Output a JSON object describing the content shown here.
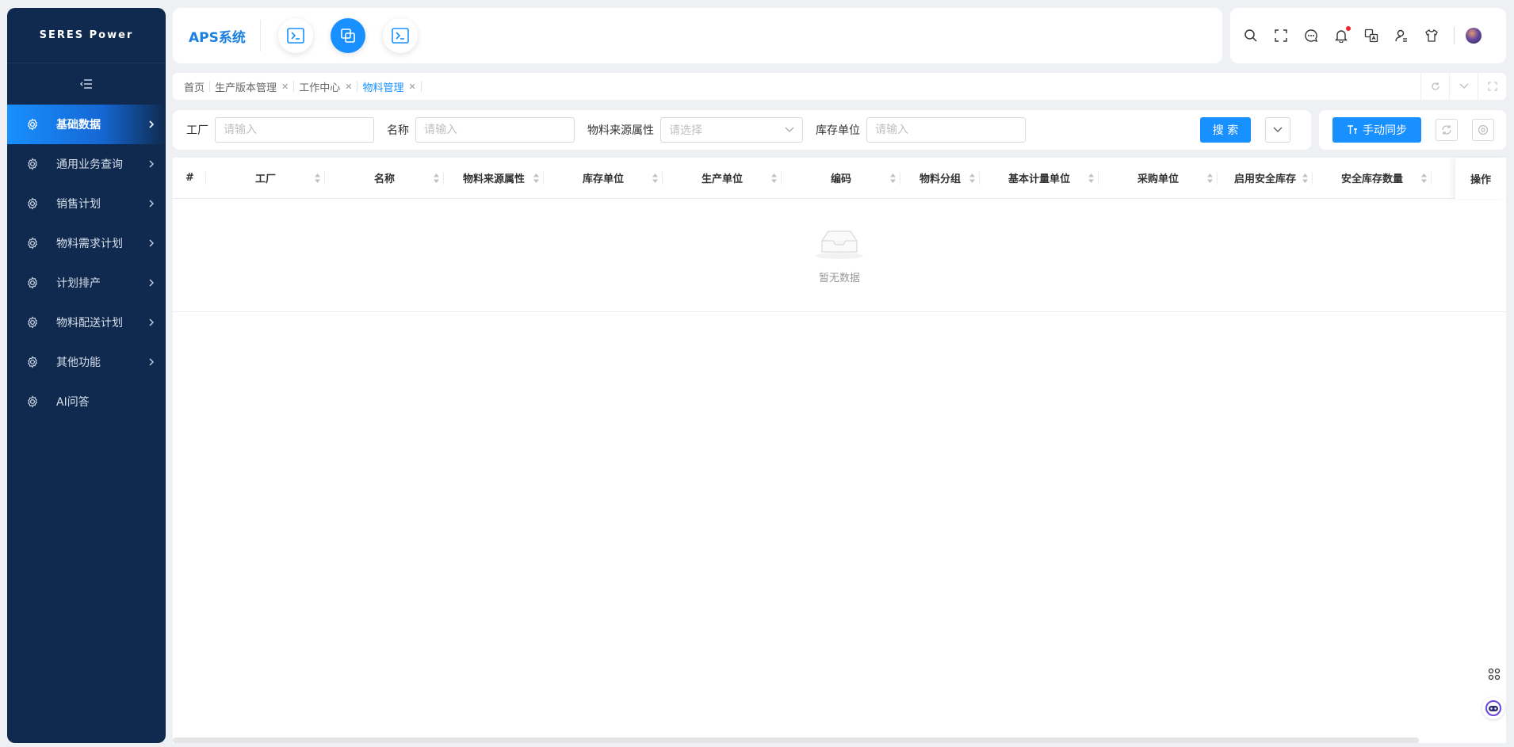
{
  "sidebar": {
    "logo": "SERES Power",
    "items": [
      {
        "label": "基础数据",
        "icon": "gear-icon",
        "active": true
      },
      {
        "label": "通用业务查询",
        "icon": "gear-icon"
      },
      {
        "label": "销售计划",
        "icon": "gear-icon"
      },
      {
        "label": "物料需求计划",
        "icon": "gear-icon"
      },
      {
        "label": "计划排产",
        "icon": "gear-icon"
      },
      {
        "label": "物料配送计划",
        "icon": "gear-icon"
      },
      {
        "label": "其他功能",
        "icon": "gear-icon"
      },
      {
        "label": "AI问答",
        "icon": "gear-icon"
      }
    ]
  },
  "header": {
    "app_title": "APS系统"
  },
  "tabs": [
    {
      "label": "首页",
      "closable": false
    },
    {
      "label": "生产版本管理",
      "closable": true
    },
    {
      "label": "工作中心",
      "closable": true
    },
    {
      "label": "物料管理",
      "closable": true,
      "active": true
    }
  ],
  "search": {
    "factory_label": "工厂",
    "factory_placeholder": "请输入",
    "name_label": "名称",
    "name_placeholder": "请输入",
    "source_label": "物料来源属性",
    "source_placeholder": "请选择",
    "unit_label": "库存单位",
    "unit_placeholder": "请输入",
    "search_button": "搜 索"
  },
  "actions": {
    "sync_button": "手动同步"
  },
  "table": {
    "columns": [
      "#",
      "工厂",
      "名称",
      "物料来源属性",
      "库存单位",
      "生产单位",
      "编码",
      "物料分组",
      "基本计量单位",
      "采购单位",
      "启用安全库存",
      "安全库存数量",
      "操作"
    ],
    "empty_text": "暂无数据"
  },
  "colors": {
    "sidebar_bg": "#0f2a4e",
    "accent": "#1890ff"
  }
}
